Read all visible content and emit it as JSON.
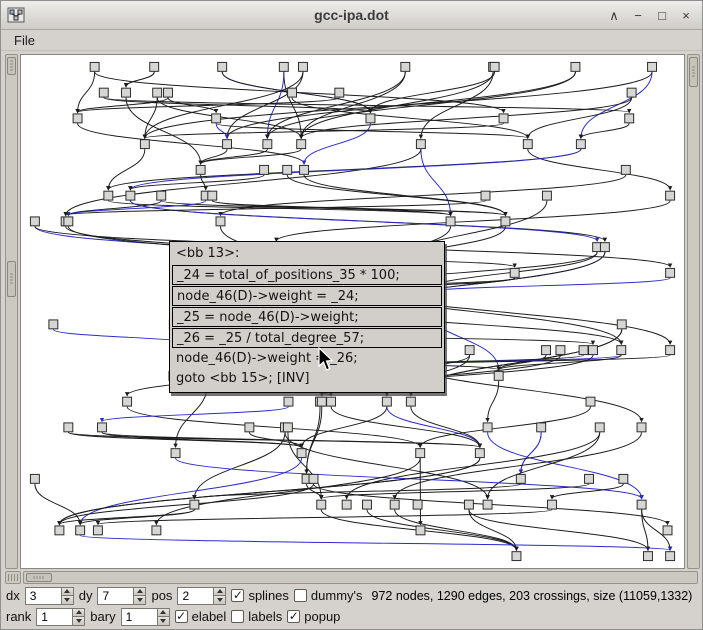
{
  "window": {
    "title": "gcc-ipa.dot",
    "icons": {
      "shade": "∧",
      "minimize": "−",
      "maximize": "□",
      "close": "×"
    },
    "menu": [
      {
        "label": "File"
      }
    ]
  },
  "popup": {
    "lines": [
      {
        "text": "<bb 13>:"
      },
      {
        "text": "_24 = total_of_positions_35 * 100;"
      },
      {
        "text": "node_46(D)->weight = _24;"
      },
      {
        "text": "_25 = node_46(D)->weight;"
      },
      {
        "text": "_26 = _25 / total_degree_57;"
      },
      {
        "text": "node_46(D)->weight = _26;"
      },
      {
        "text": "goto <bb 15>; [INV]"
      }
    ]
  },
  "controls": {
    "dx": {
      "label": "dx",
      "value": "3"
    },
    "dy": {
      "label": "dy",
      "value": "7"
    },
    "pos": {
      "label": "pos",
      "value": "2"
    },
    "rank": {
      "label": "rank",
      "value": "1"
    },
    "bary": {
      "label": "bary",
      "value": "1"
    },
    "splines": {
      "label": "splines",
      "checked": true
    },
    "dummys": {
      "label": "dummy's",
      "checked": false
    },
    "elabel": {
      "label": "elabel",
      "checked": true
    },
    "labels": {
      "label": "labels",
      "checked": false
    },
    "popup": {
      "label": "popup",
      "checked": true
    },
    "status": "972 nodes, 1290 edges, 203 crossings, size (11059,1332)"
  },
  "graph": {
    "node_fill": "#d6d6d4",
    "node_stroke": "#2b2b2b",
    "edge_color": "#1c1c1c",
    "edge_alt_color": "#2a2ad0"
  }
}
